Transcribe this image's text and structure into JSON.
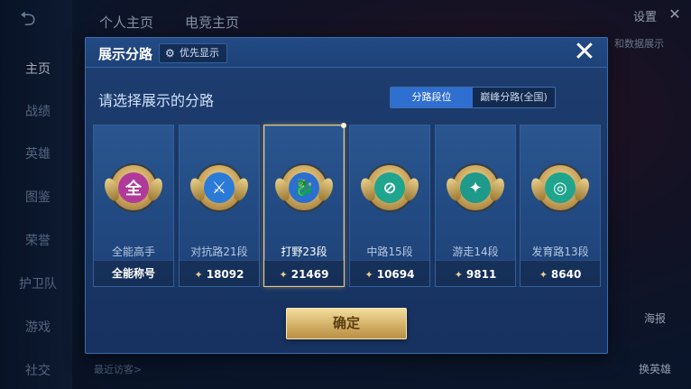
{
  "background": {
    "nav": [
      "主页",
      "战绩",
      "英雄",
      "图鉴",
      "荣誉",
      "护卫队",
      "游戏",
      "社交"
    ],
    "top_tabs": [
      "个人主页",
      "电竞主页"
    ],
    "settings_label": "设置",
    "bg_hint": "和数据展示",
    "bottom_hint": "最近访客>",
    "side_buttons": [
      "海报",
      "换英雄"
    ]
  },
  "dialog": {
    "title": "展示分路",
    "priority_label": "优先显示",
    "prompt": "请选择展示的分路",
    "toggle": {
      "options": [
        "分路段位",
        "巅峰分路(全国)"
      ],
      "selected": "分路段位"
    },
    "cards": [
      {
        "name": "全能高手",
        "value": "全能称号",
        "emblem": "全",
        "color": "#b03a9a",
        "selected": false,
        "has_value_icon": false
      },
      {
        "name": "对抗路21段",
        "value": "18092",
        "emblem": "⚔",
        "color": "#2a7ad8",
        "selected": false,
        "has_value_icon": true
      },
      {
        "name": "打野23段",
        "value": "21469",
        "emblem": "🐉",
        "color": "#2b6fd0",
        "selected": true,
        "has_value_icon": true
      },
      {
        "name": "中路15段",
        "value": "10694",
        "emblem": "⊘",
        "color": "#1fa58d",
        "selected": false,
        "has_value_icon": true
      },
      {
        "name": "游走14段",
        "value": "9811",
        "emblem": "✦",
        "color": "#1f9a8a",
        "selected": false,
        "has_value_icon": true
      },
      {
        "name": "发育路13段",
        "value": "8640",
        "emblem": "◎",
        "color": "#1fa58d",
        "selected": false,
        "has_value_icon": true
      }
    ],
    "confirm_label": "确定"
  }
}
